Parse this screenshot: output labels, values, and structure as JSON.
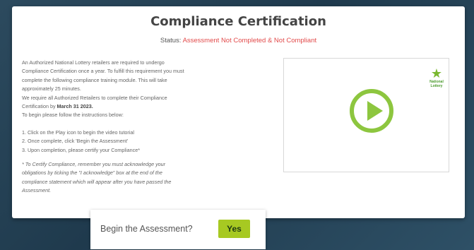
{
  "header": {
    "title": "Compliance Certification",
    "status_label": "Status:",
    "status_value": "Assessment Not Completed & Not Compliant"
  },
  "instructions": {
    "intro_lines": [
      "An Authorized National Lottery retailers are required to undergo",
      "Compliance Certification once a year. To fulfill this requirement you must",
      "complete the following compliance training module. This will take",
      "approximately 25 minutes."
    ],
    "deadline_line1": "We require all Authorized Retailers to complete their Compliance",
    "deadline_prefix": "Certification by",
    "deadline_date": "March 31 2023.",
    "begin_line": "To begin please follow the instructions below:",
    "steps": [
      "1. Click on the Play icon to begin the video tutorial",
      "2. Once complete, click 'Begin the Assessment'",
      "3. Upon completion, please certify your Compliance*"
    ],
    "note_lines": [
      "* To Certify Compliance, remember you must acknowledge your",
      "obligations by ticking the \"I acknowledge\" box at the end of the",
      "compliance statement which will appear after you have passed the",
      "Assessment."
    ]
  },
  "video": {
    "play_icon": "play-icon",
    "logo_icon": "star-icon",
    "logo_text": "National Lottery"
  },
  "prompt": {
    "question": "Begin the Assessment?",
    "yes_label": "Yes"
  },
  "colors": {
    "accent_green": "#8dc63f",
    "yes_button": "#a7c922",
    "status_red": "#e24a4a",
    "background": "#2c4a5e"
  }
}
